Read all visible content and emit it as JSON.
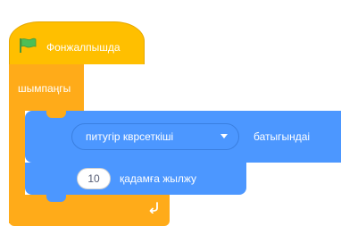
{
  "hat_block": {
    "label": "Фонжалпышда"
  },
  "forever_block": {
    "label": "шымпаңгы"
  },
  "sensing_block": {
    "dropdown_value": "питугір кврсеткішi",
    "suffix_label": "батыгындаі"
  },
  "move_block": {
    "steps_value": "10",
    "label": "қадамға жылжу"
  },
  "colors": {
    "events": "#ffbf00",
    "control": "#ffab19",
    "motion": "#4c97ff",
    "flag": "#4cbf56"
  },
  "icons": {
    "flag": "green-flag-icon",
    "dropdown": "dropdown-arrow-icon",
    "loop": "loop-arrow-icon"
  }
}
